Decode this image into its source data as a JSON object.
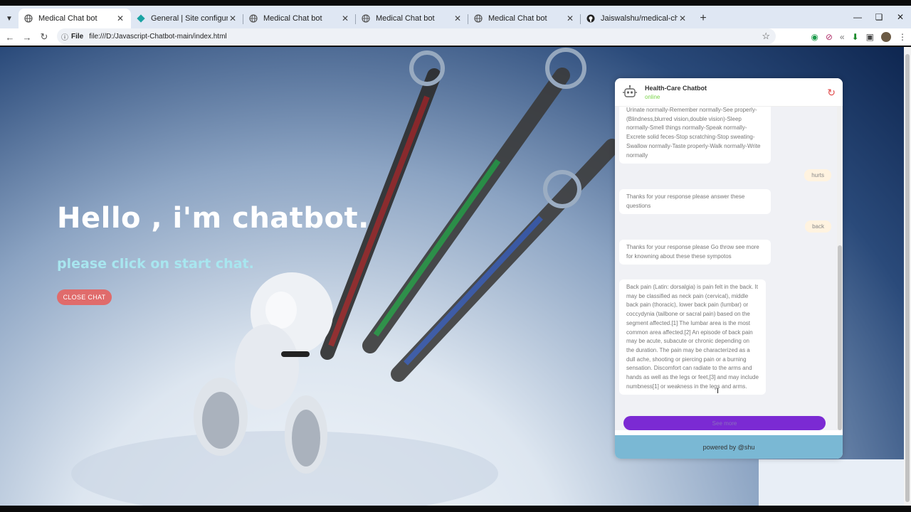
{
  "browser": {
    "tabs": [
      {
        "title": "Medical Chat bot",
        "active": true,
        "icon": "globe-icon"
      },
      {
        "title": "General | Site configuration | sp",
        "active": false,
        "icon": "diamond-icon"
      },
      {
        "title": "Medical Chat bot",
        "active": false,
        "icon": "globe-icon"
      },
      {
        "title": "Medical Chat bot",
        "active": false,
        "icon": "globe-icon"
      },
      {
        "title": "Medical Chat bot",
        "active": false,
        "icon": "globe-icon"
      },
      {
        "title": "Jaiswalshu/medical-chatbot",
        "active": false,
        "icon": "github-icon"
      }
    ],
    "address": {
      "scheme_label": "File",
      "url": "file:///D:/Javascript-Chatbot-main/index.html"
    }
  },
  "hero": {
    "heading": "Hello , i'm chatbot.",
    "subheading": "please click on start chat.",
    "close_button": "CLOSE CHAT"
  },
  "chat": {
    "title": "Health-Care Chatbot",
    "status": "online",
    "messages": [
      {
        "from": "bot",
        "text": "Urinate normally-Remember normally-See properly-(Blindness,blurred vision,double vision)-Sleep normally-Smell things normally-Speak normally-Excrete solid feces-Stop scratching-Stop sweating-Swallow normally-Taste properly-Walk normally-Write normally"
      },
      {
        "from": "user",
        "text": "hurts"
      },
      {
        "from": "bot",
        "text": "Thanks for your response please answer these questions"
      },
      {
        "from": "user",
        "text": "back"
      },
      {
        "from": "bot",
        "text": "Thanks for your response please Go throw see more for knowning about these these sympotos"
      },
      {
        "from": "bot",
        "text": "Back pain (Latin: dorsalgia) is pain felt in the back. It may be classified as neck pain (cervical), middle back pain (thoracic), lower back pain (lumbar) or coccydynia (tailbone or sacral pain) based on the segment affected.[1] The lumbar area is the most common area affected.[2] An episode of back pain may be acute, subacute or chronic depending on the duration. The pain may be characterized as a dull ache, shooting or piercing pain or a burning sensation. Discomfort can radiate to the arms and hands as well as the legs or feet,[3] and may include numbness[1] or weakness in the legs and arms."
      }
    ],
    "see_more": "See more",
    "footer": "powered by @shu"
  },
  "colors": {
    "accent_purple": "#7b2ad3",
    "close_button": "#e06b6b",
    "status_online": "#7ad34a",
    "footer_bg": "#7ab8d4"
  }
}
